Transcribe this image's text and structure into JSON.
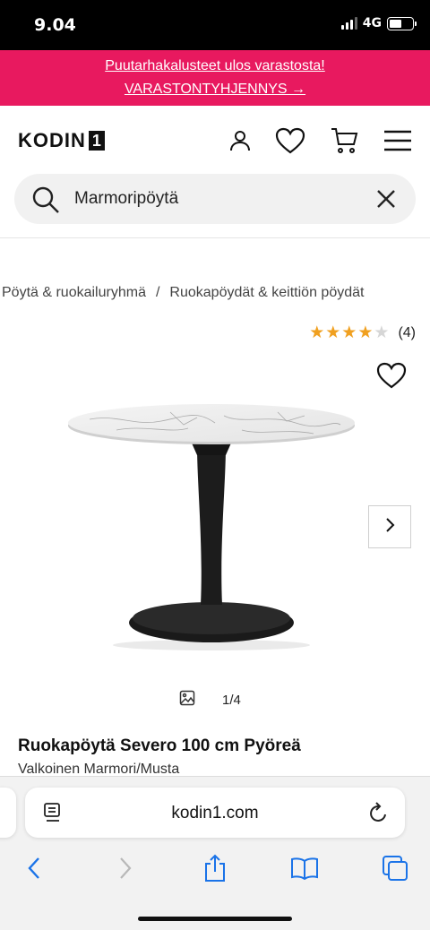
{
  "status": {
    "time": "9.04",
    "network": "4G",
    "battery_level": 0.55
  },
  "promo": {
    "line1": "Puutarhakalusteet ulos varastosta!",
    "line2": "VARASTONTYHJENNYS →",
    "bg": "#e8195f"
  },
  "header": {
    "logo_text": "KODIN",
    "logo_number": "1",
    "icons": [
      "account-icon",
      "heart-icon",
      "cart-icon",
      "menu-icon"
    ]
  },
  "search": {
    "value": "Marmoripöytä",
    "placeholder": "",
    "icon": "search-icon",
    "clear_icon": "close-icon"
  },
  "breadcrumb": {
    "items": [
      "Pöytä & ruokailuryhmä",
      "Ruokapöydät & keittiön pöydät"
    ],
    "separator": "/"
  },
  "rating": {
    "stars": 4,
    "max": 5,
    "count": "(4)",
    "star_color": "#f0a020"
  },
  "gallery": {
    "counter": "1/4",
    "icon": "image-icon",
    "next_icon": "chevron-right-icon",
    "favorite_icon": "heart-outline-icon"
  },
  "product": {
    "title": "Ruokapöytä Severo 100 cm Pyöreä",
    "subtitle": "Valkoinen Marmori/Musta"
  },
  "browser": {
    "url": "kodin1.com",
    "toolbar": [
      "back-icon",
      "forward-icon",
      "share-icon",
      "bookmarks-icon",
      "tabs-icon"
    ],
    "accent": "#1a73e8"
  }
}
